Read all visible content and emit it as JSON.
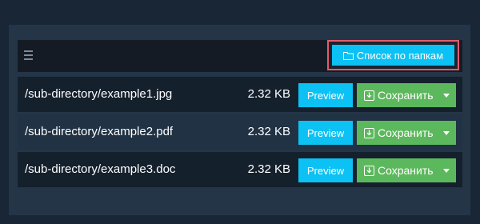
{
  "toolbar": {
    "menu_icon": "hamburger-menu-icon",
    "folder_icon": "folder-icon",
    "folder_list_label": "Список по папкам"
  },
  "files": [
    {
      "name": "/sub-directory/example1.jpg",
      "size": "2.32 KB",
      "preview_label": "Preview",
      "save_label": "Сохранить"
    },
    {
      "name": "/sub-directory/example2.pdf",
      "size": "2.32 KB",
      "preview_label": "Preview",
      "save_label": "Сохранить"
    },
    {
      "name": "/sub-directory/example3.doc",
      "size": "2.32 KB",
      "preview_label": "Preview",
      "save_label": "Сохранить"
    }
  ],
  "colors": {
    "page_bg": "#192636",
    "panel_bg": "#243548",
    "toolbar_bg": "#141b24",
    "row_dark": "#15202d",
    "row_light": "#203244",
    "accent_blue": "#0cc1f3",
    "success_green": "#5cb85c",
    "highlight_border": "#e35d6a"
  }
}
